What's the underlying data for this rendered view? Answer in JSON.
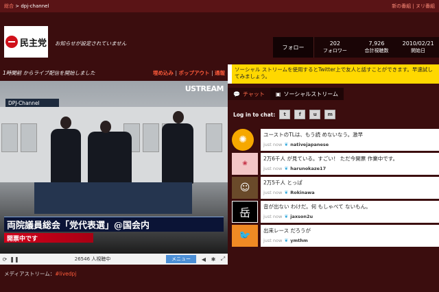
{
  "topbar": {
    "home": "総合",
    "channel": "dpj-channel",
    "right_links": "新の番組 | ヌリ番組"
  },
  "header": {
    "logo_text": "民主党",
    "notice": "お知らせが設定されていません",
    "follow_label": "フォロー",
    "stats": [
      {
        "num": "202",
        "label": "フォロワー"
      },
      {
        "num": "7,926",
        "label": "合計視聴数"
      },
      {
        "num": "2010/02/21",
        "label": "開始日"
      }
    ]
  },
  "video_head": {
    "live_time": "1時間前",
    "live_text": "からライブ配信を開始しました",
    "links": [
      "埋め込み",
      "ポップアウト",
      "通報"
    ]
  },
  "video": {
    "brand": "USTREAM",
    "channel_tag": "DPJ-Channel",
    "caption": "両院議員総会「党代表選」@国会内",
    "red_bar": "開票中です"
  },
  "controls": {
    "viewers": "26546 人視聴中",
    "menu": "メニュー"
  },
  "media": {
    "label": "メディアストリーム：",
    "tag": "#livedpj"
  },
  "social_notice": "ソーシャル ストリームを使用するとTwitter上で友人と話すことができます。早速試してみましょう。",
  "tabs": {
    "chat": "チャット",
    "social": "ソーシャルストリーム"
  },
  "login": {
    "label": "Log in to chat:"
  },
  "feed": [
    {
      "msg": "ユーストのTLは、もう読 めないなう。激早",
      "time": "just now",
      "user": "nativejapanese",
      "avatar": "orange"
    },
    {
      "msg": "2万6千人 が見ている。すごい！ ただ今開票 作業中です。",
      "time": "just now",
      "user": "harunokaze17",
      "avatar": "pink"
    },
    {
      "msg": "2万5千人 とっぱ",
      "time": "just now",
      "user": "Rokinawa",
      "avatar": "face"
    },
    {
      "msg": "音が出ない わけだ。何 もしゃべて ないもん。",
      "time": "just now",
      "user": "jaxson2u",
      "avatar": "kanji"
    },
    {
      "msg": "出来レース だろうが",
      "time": "just now",
      "user": "ymthm",
      "avatar": "bird"
    }
  ]
}
